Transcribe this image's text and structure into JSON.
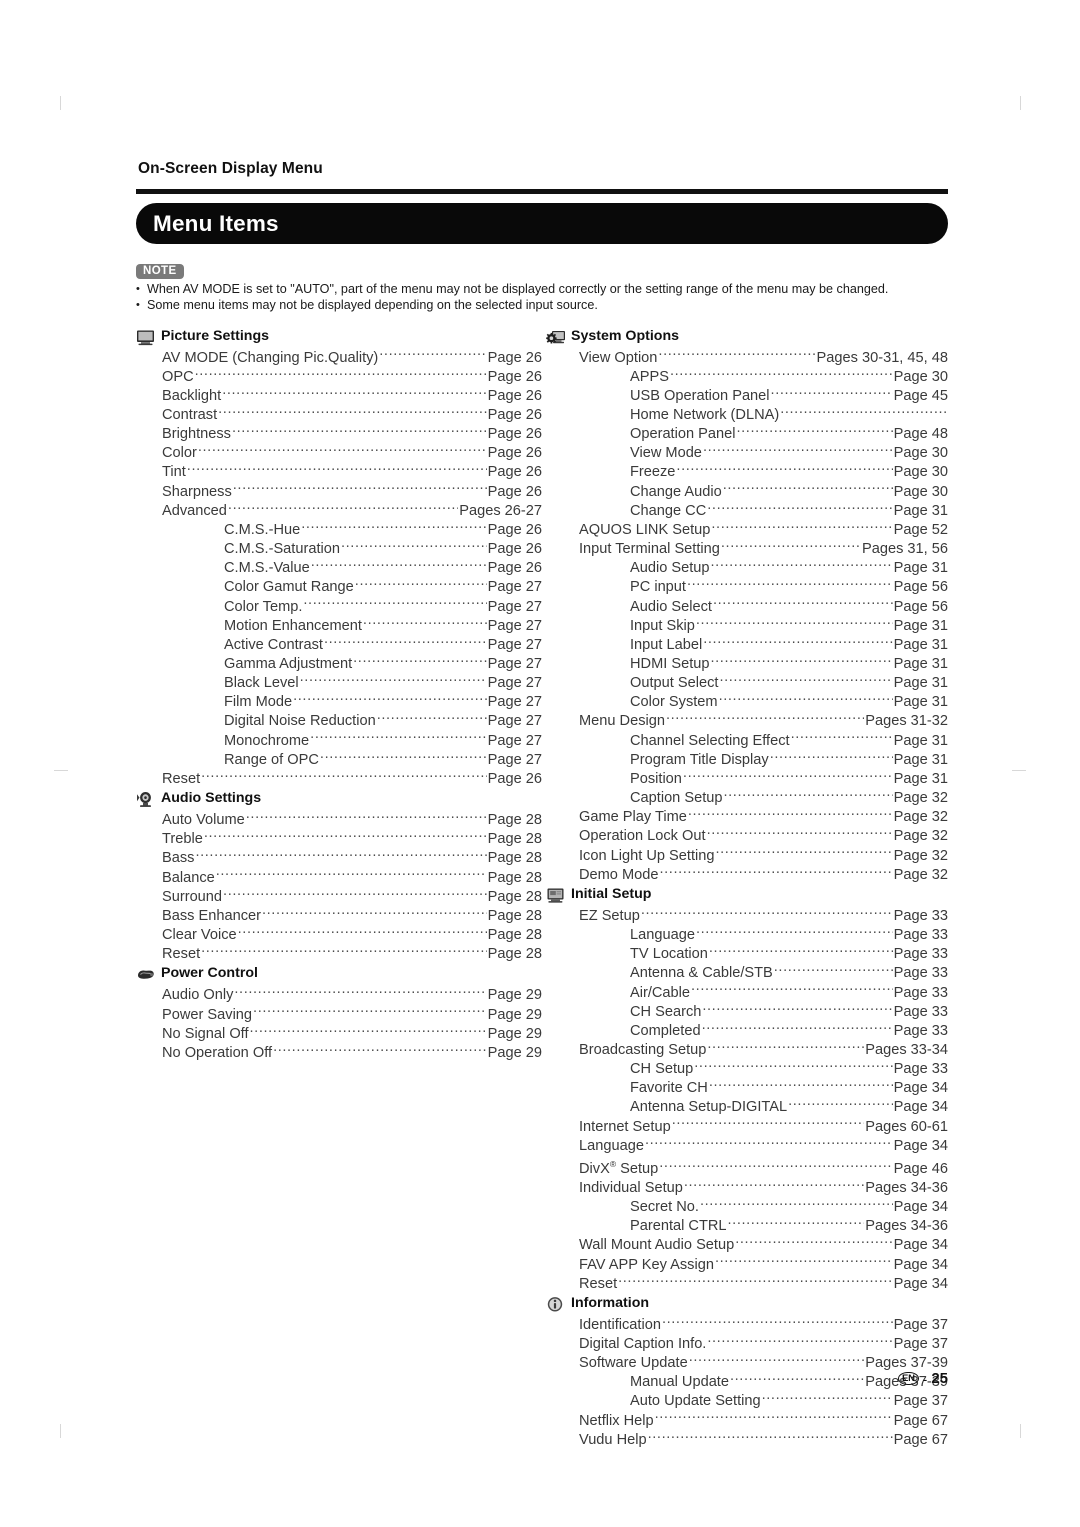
{
  "page": {
    "chapter_title": "On-Screen Display Menu",
    "banner_title": "Menu Items",
    "footer_locale": "EN",
    "footer_dash": "-",
    "footer_page_number": "25"
  },
  "note": {
    "badge": "NOTE",
    "items": [
      "When AV MODE is set to \"AUTO\", part of the menu may not be displayed correctly or the setting range of the menu may be changed.",
      "Some menu items may not be displayed depending on the selected input source."
    ]
  },
  "left_column": [
    {
      "icon": "tv-monitor-icon",
      "title": "Picture Settings",
      "entries": [
        {
          "label": "AV MODE (Changing Pic.Quality)",
          "page": "Page 26",
          "level": 1,
          "leader": false
        },
        {
          "label": "OPC",
          "page": "Page 26",
          "level": 1,
          "leader": true
        },
        {
          "label": "Backlight",
          "page": "Page 26",
          "level": 1,
          "leader": true
        },
        {
          "label": "Contrast",
          "page": "Page 26",
          "level": 1,
          "leader": true
        },
        {
          "label": "Brightness",
          "page": "Page 26",
          "level": 1,
          "leader": true
        },
        {
          "label": "Color",
          "page": "Page 26",
          "level": 1,
          "leader": true
        },
        {
          "label": "Tint",
          "page": "Page 26",
          "level": 1,
          "leader": true
        },
        {
          "label": "Sharpness",
          "page": "Page 26",
          "level": 1,
          "leader": true
        },
        {
          "label": "Advanced",
          "page": "Pages 26-27",
          "level": 1,
          "leader": true
        },
        {
          "label": "C.M.S.-Hue",
          "page": "Page 26",
          "level": 2,
          "leader": true
        },
        {
          "label": "C.M.S.-Saturation",
          "page": "Page 26",
          "level": 2,
          "leader": true
        },
        {
          "label": "C.M.S.-Value",
          "page": "Page 26",
          "level": 2,
          "leader": true
        },
        {
          "label": "Color Gamut Range",
          "page": "Page 27",
          "level": 2,
          "leader": true
        },
        {
          "label": "Color Temp.",
          "page": "Page 27",
          "level": 2,
          "leader": true
        },
        {
          "label": "Motion Enhancement",
          "page": "Page 27",
          "level": 2,
          "leader": true
        },
        {
          "label": "Active Contrast",
          "page": "Page 27",
          "level": 2,
          "leader": true
        },
        {
          "label": "Gamma Adjustment",
          "page": "Page 27",
          "level": 2,
          "leader": true
        },
        {
          "label": "Black Level",
          "page": "Page 27",
          "level": 2,
          "leader": true
        },
        {
          "label": "Film Mode",
          "page": "Page 27",
          "level": 2,
          "leader": true
        },
        {
          "label": "Digital Noise Reduction",
          "page": "Page 27",
          "level": 2,
          "leader": true
        },
        {
          "label": "Monochrome",
          "page": "Page 27",
          "level": 2,
          "leader": true
        },
        {
          "label": "Range of OPC",
          "page": "Page 27",
          "level": 2,
          "leader": true
        },
        {
          "label": "Reset",
          "page": "Page 26",
          "level": 1,
          "leader": true
        }
      ]
    },
    {
      "icon": "speaker-icon",
      "title": "Audio Settings",
      "entries": [
        {
          "label": "Auto Volume",
          "page": "Page 28",
          "level": 1,
          "leader": true
        },
        {
          "label": "Treble",
          "page": "Page 28",
          "level": 1,
          "leader": true
        },
        {
          "label": "Bass",
          "page": "Page 28",
          "level": 1,
          "leader": true
        },
        {
          "label": "Balance",
          "page": "Page 28",
          "level": 1,
          "leader": true
        },
        {
          "label": "Surround",
          "page": "Page 28",
          "level": 1,
          "leader": true
        },
        {
          "label": "Bass Enhancer",
          "page": "Page 28",
          "level": 1,
          "leader": true
        },
        {
          "label": "Clear Voice",
          "page": "Page 28",
          "level": 1,
          "leader": true
        },
        {
          "label": "Reset",
          "page": "Page 28",
          "level": 1,
          "leader": true
        }
      ]
    },
    {
      "icon": "power-plug-icon",
      "title": "Power Control",
      "entries": [
        {
          "label": "Audio Only",
          "page": "Page 29",
          "level": 1,
          "leader": true
        },
        {
          "label": "Power Saving",
          "page": "Page 29",
          "level": 1,
          "leader": true
        },
        {
          "label": "No Signal Off",
          "page": "Page 29",
          "level": 1,
          "leader": true
        },
        {
          "label": "No Operation Off",
          "page": "Page 29",
          "level": 1,
          "leader": true
        }
      ]
    }
  ],
  "right_column": [
    {
      "icon": "gear-tv-icon",
      "title": "System Options",
      "entries": [
        {
          "label": "View Option",
          "page": "Pages 30-31, 45, 48",
          "level": 1,
          "leader": true
        },
        {
          "label": "APPS",
          "page": "Page 30",
          "level": 2,
          "leader": true
        },
        {
          "label": "USB Operation Panel",
          "page": "Page 45",
          "level": 2,
          "leader": true
        },
        {
          "label": "Home Network (DLNA)",
          "page": "",
          "level": 2,
          "leader": false
        },
        {
          "label": "Operation Panel",
          "page": "Page 48",
          "level": 2,
          "leader": true
        },
        {
          "label": "View Mode",
          "page": "Page 30",
          "level": 2,
          "leader": true
        },
        {
          "label": "Freeze",
          "page": "Page 30",
          "level": 2,
          "leader": true
        },
        {
          "label": "Change Audio",
          "page": "Page 30",
          "level": 2,
          "leader": true
        },
        {
          "label": "Change CC",
          "page": "Page 31",
          "level": 2,
          "leader": true
        },
        {
          "label": "AQUOS LINK Setup",
          "page": "Page 52",
          "level": 1,
          "leader": true
        },
        {
          "label": "Input Terminal Setting",
          "page": "Pages 31, 56",
          "level": 1,
          "leader": true
        },
        {
          "label": "Audio Setup",
          "page": "Page 31",
          "level": 2,
          "leader": true
        },
        {
          "label": "PC input",
          "page": "Page 56",
          "level": 2,
          "leader": true
        },
        {
          "label": "Audio Select",
          "page": "Page 56",
          "level": 2,
          "leader": true
        },
        {
          "label": "Input Skip",
          "page": "Page 31",
          "level": 2,
          "leader": true
        },
        {
          "label": "Input Label",
          "page": "Page 31",
          "level": 2,
          "leader": true
        },
        {
          "label": "HDMI Setup",
          "page": "Page 31",
          "level": 2,
          "leader": true
        },
        {
          "label": "Output Select",
          "page": "Page 31",
          "level": 2,
          "leader": true
        },
        {
          "label": "Color System",
          "page": "Page 31",
          "level": 2,
          "leader": true
        },
        {
          "label": "Menu Design",
          "page": "Pages 31-32",
          "level": 1,
          "leader": true
        },
        {
          "label": "Channel Selecting Effect",
          "page": "Page 31",
          "level": 2,
          "leader": true
        },
        {
          "label": "Program Title Display",
          "page": "Page 31",
          "level": 2,
          "leader": true
        },
        {
          "label": "Position",
          "page": "Page 31",
          "level": 2,
          "leader": true
        },
        {
          "label": "Caption Setup",
          "page": "Page 32",
          "level": 2,
          "leader": true
        },
        {
          "label": "Game Play Time",
          "page": "Page 32",
          "level": 1,
          "leader": true
        },
        {
          "label": "Operation Lock Out",
          "page": "Page 32",
          "level": 1,
          "leader": true
        },
        {
          "label": "Icon Light Up Setting",
          "page": "Page 32",
          "level": 1,
          "leader": true
        },
        {
          "label": "Demo Mode",
          "page": "Page 32",
          "level": 1,
          "leader": true
        }
      ]
    },
    {
      "icon": "setup-screen-icon",
      "title": "Initial Setup",
      "entries": [
        {
          "label": "EZ Setup",
          "page": "Page 33",
          "level": 1,
          "leader": true
        },
        {
          "label": "Language",
          "page": "Page 33",
          "level": 2,
          "leader": true
        },
        {
          "label": "TV Location",
          "page": "Page 33",
          "level": 2,
          "leader": true
        },
        {
          "label": "Antenna & Cable/STB",
          "page": "Page 33",
          "level": 2,
          "leader": true
        },
        {
          "label": "Air/Cable",
          "page": "Page 33",
          "level": 2,
          "leader": true
        },
        {
          "label": "CH Search",
          "page": "Page 33",
          "level": 2,
          "leader": true
        },
        {
          "label": "Completed",
          "page": "Page 33",
          "level": 2,
          "leader": true
        },
        {
          "label": "Broadcasting Setup",
          "page": "Pages 33-34",
          "level": 1,
          "leader": true
        },
        {
          "label": "CH Setup",
          "page": "Page 33",
          "level": 2,
          "leader": true
        },
        {
          "label": "Favorite CH",
          "page": "Page 34",
          "level": 2,
          "leader": true
        },
        {
          "label": "Antenna Setup-DIGITAL",
          "page": "Page 34",
          "level": 2,
          "leader": true
        },
        {
          "label": "Internet Setup",
          "page": "Pages 60-61",
          "level": 1,
          "leader": true
        },
        {
          "label": "Language",
          "page": "Page 34",
          "level": 1,
          "leader": true
        },
        {
          "label": "DivX® Setup",
          "page": "Page 46",
          "level": 1,
          "leader": true
        },
        {
          "label": "Individual Setup",
          "page": "Pages 34-36",
          "level": 1,
          "leader": true
        },
        {
          "label": "Secret No.",
          "page": "Page 34",
          "level": 2,
          "leader": true
        },
        {
          "label": "Parental CTRL",
          "page": "Pages 34-36",
          "level": 2,
          "leader": true
        },
        {
          "label": "Wall Mount Audio Setup",
          "page": "Page 34",
          "level": 1,
          "leader": true
        },
        {
          "label": "FAV APP Key Assign",
          "page": "Page 34",
          "level": 1,
          "leader": true
        },
        {
          "label": "Reset",
          "page": "Page 34",
          "level": 1,
          "leader": true
        }
      ]
    },
    {
      "icon": "info-circle-icon",
      "title": "Information",
      "entries": [
        {
          "label": "Identification",
          "page": "Page 37",
          "level": 1,
          "leader": true
        },
        {
          "label": "Digital Caption Info.",
          "page": "Page 37",
          "level": 1,
          "leader": true
        },
        {
          "label": "Software Update",
          "page": "Pages 37-39",
          "level": 1,
          "leader": true
        },
        {
          "label": "Manual Update",
          "page": "Pages 37-39",
          "level": 2,
          "leader": true
        },
        {
          "label": "Auto Update Setting",
          "page": "Page 37",
          "level": 2,
          "leader": true
        },
        {
          "label": "Netflix Help",
          "page": "Page 67",
          "level": 1,
          "leader": true
        },
        {
          "label": "Vudu Help",
          "page": "Page 67",
          "level": 1,
          "leader": true
        }
      ]
    }
  ]
}
